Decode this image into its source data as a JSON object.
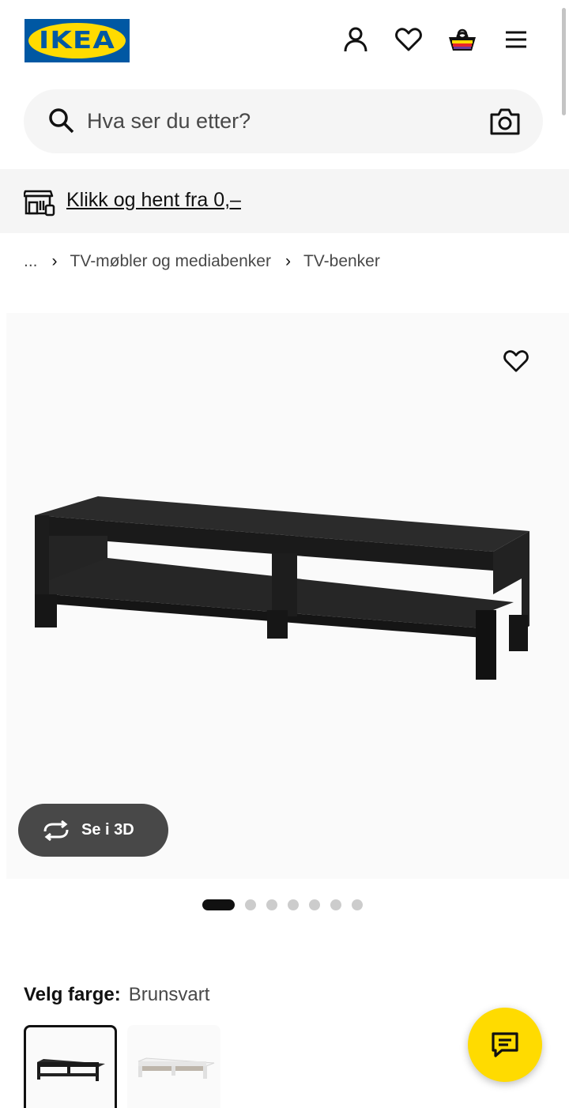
{
  "header": {
    "logo_text": "IKEA",
    "brand_colors": {
      "blue": "#0058a3",
      "yellow": "#ffdb00"
    },
    "icons": [
      "user-icon",
      "heart-icon",
      "shopping-bag-icon",
      "menu-icon"
    ]
  },
  "search": {
    "placeholder": "Hva ser du etter?",
    "icons": [
      "search-icon",
      "camera-icon"
    ]
  },
  "banner": {
    "link_text": "Klikk og hent fra 0,–",
    "icon": "store-icon"
  },
  "breadcrumb": {
    "ellipsis": "...",
    "separator": "›",
    "items": [
      "TV-møbler og mediabenker",
      "TV-benker"
    ]
  },
  "product": {
    "see_3d_label": "Se i 3D",
    "image_count": 7,
    "active_image_index": 0
  },
  "color": {
    "label": "Velg farge:",
    "selected_value": "Brunsvart",
    "options": [
      {
        "name": "black-brown-swatch",
        "color": "#2a2a2a",
        "selected": true
      },
      {
        "name": "white-swatch",
        "color": "#f2f2f2",
        "selected": false
      }
    ]
  },
  "chat": {
    "icon": "chat-icon",
    "color": "#ffdb00"
  }
}
